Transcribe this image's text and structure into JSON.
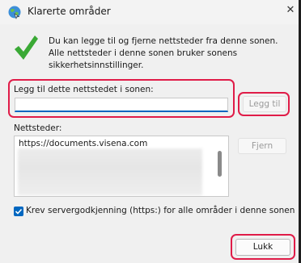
{
  "window": {
    "title": "Klarerte områder",
    "close_glyph": "✕"
  },
  "info": {
    "text": "Du kan legge til og fjerne nettsteder fra denne sonen. Alle nettsteder i denne sonen bruker sonens sikkerhetsinnstillinger."
  },
  "add_site": {
    "label": "Legg til dette nettstedet i sonen:",
    "value": "",
    "button_label": "Legg til"
  },
  "sites": {
    "label": "Nettsteder:",
    "items": [
      "https://documents.visena.com"
    ],
    "remove_label": "Fjern"
  },
  "require_https": {
    "checked": true,
    "label": "Krev servergodkjenning (https:) for alle områder i denne sonen"
  },
  "footer": {
    "close_label": "Lukk"
  },
  "colors": {
    "accent": "#0067c0",
    "highlight": "#e01c48",
    "check_green": "#3aa935"
  }
}
